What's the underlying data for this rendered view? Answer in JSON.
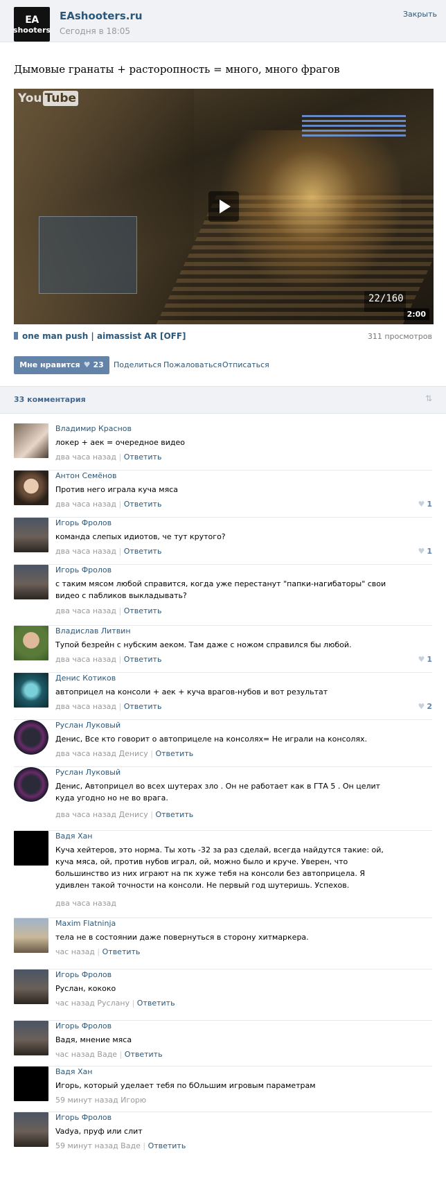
{
  "header": {
    "group_logo_line1": "EA",
    "group_logo_line2": "shooters",
    "group_name": "EAshooters.ru",
    "post_time": "Сегодня в 18:05",
    "close_label": "Закрыть"
  },
  "post": {
    "title": "Дымовые гранаты + расторопность = много, много фрагов",
    "video": {
      "watermark": "You",
      "watermark_box": "Tube",
      "hud_ammo": "22/160",
      "duration": "2:00",
      "title": "one man push | aimassist AR [OFF]",
      "views": "311 просмотров"
    },
    "actions": {
      "like_label": "Мне нравится",
      "like_count": "23",
      "share_label": "Поделиться",
      "report_label": "Пожаловаться",
      "unsubscribe_label": "Отписаться"
    }
  },
  "comments_header": {
    "count_label": "33 комментария",
    "sort_icon": "sort-arrows-icon"
  },
  "comments": [
    {
      "author": "Владимир Краснов",
      "text": "локер + аек = очередное видео",
      "time": "два часа назад",
      "reply_to": "",
      "reply": "Ответить",
      "likes": ""
    },
    {
      "author": "Антон Семёнов",
      "text": "Против него играла куча мяса",
      "time": "два часа назад",
      "reply_to": "",
      "reply": "Ответить",
      "likes": "1"
    },
    {
      "author": "Игорь Фролов",
      "text": "команда слепых идиотов, че тут крутого?",
      "time": "два часа назад",
      "reply_to": "",
      "reply": "Ответить",
      "likes": "1"
    },
    {
      "author": "Игорь Фролов",
      "text": "с таким мясом любой справится, когда уже перестанут \"папки-нагибаторы\" свои видео с пабликов выкладывать?",
      "time": "два часа назад",
      "reply_to": "",
      "reply": "Ответить",
      "likes": ""
    },
    {
      "author": "Владислав Литвин",
      "text": "Тупой безрейн с нубским аеком. Там даже с ножом справился бы любой.",
      "time": "два часа назад",
      "reply_to": "",
      "reply": "Ответить",
      "likes": "1"
    },
    {
      "author": "Денис Котиков",
      "text": "автоприцел на консоли + аек + куча врагов-нубов и вот результат",
      "time": "два часа назад",
      "reply_to": "",
      "reply": "Ответить",
      "likes": "2"
    },
    {
      "author": "Руслан Луковый",
      "text": "Денис, Все кто говорит о автоприцеле на консолях= Не играли на консолях.",
      "time": "два часа назад",
      "reply_to": "Денису",
      "reply": "Ответить",
      "likes": ""
    },
    {
      "author": "Руслан Луковый",
      "text": "Денис, Автоприцел во всех шутерах зло . Он не работает как в ГТА 5 . Он целит куда угодно но не во врага.",
      "time": "два часа назад",
      "reply_to": "Денису",
      "reply": "Ответить",
      "likes": ""
    },
    {
      "author": "Вадя Хан",
      "text": "Куча хейтеров, это норма. Ты хоть -32 за раз сделай, всегда найдутся такие: ой, куча мяса, ой, против нубов играл, ой, можно было и круче. Уверен, что большинство из них играют на пк хуже тебя на консоли без автоприцела. Я удивлен такой точности на консоли. Не первый год шутеришь. Успехов.",
      "time": "два часа назад",
      "reply_to": "",
      "reply": "",
      "likes": ""
    },
    {
      "author": "Maxim Flatninja",
      "text": "тела не в состоянии даже повернуться в сторону хитмаркера.",
      "time": "час назад",
      "reply_to": "",
      "reply": "Ответить",
      "likes": ""
    },
    {
      "author": "Игорь Фролов",
      "text": "Руслан, кококо",
      "time": "час назад",
      "reply_to": "Руслану",
      "reply": "Ответить",
      "likes": ""
    },
    {
      "author": "Игорь Фролов",
      "text": "Вадя, мнение мяса",
      "time": "час назад",
      "reply_to": "Ваде",
      "reply": "Ответить",
      "likes": ""
    },
    {
      "author": "Вадя Хан",
      "text": "Игорь, который уделает тебя по бОльшим игровым параметрам",
      "time": "59 минут назад",
      "reply_to": "Игорю",
      "reply": "",
      "likes": ""
    },
    {
      "author": "Игорь Фролов",
      "text": "Vadya, пруф или слит",
      "time": "59 минут назад",
      "reply_to": "Ваде",
      "reply": "Ответить",
      "likes": ""
    }
  ]
}
